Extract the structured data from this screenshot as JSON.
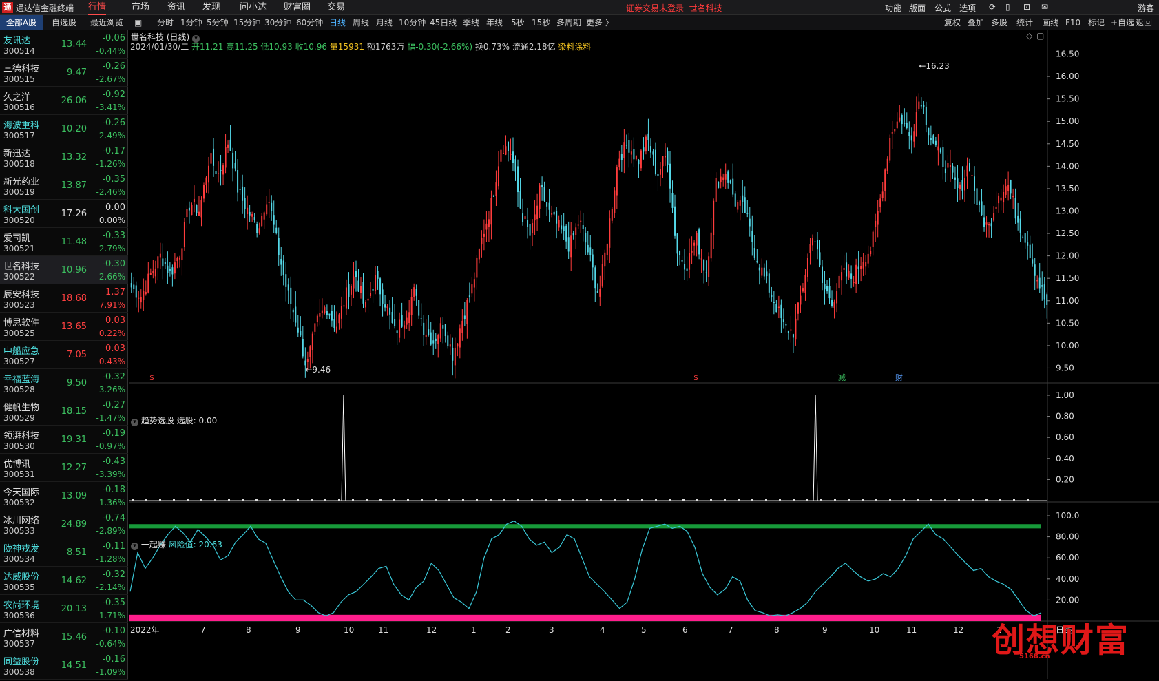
{
  "titlebar": {
    "app_name": "通达信金融终端",
    "logo_glyph": "通",
    "menus": [
      "行情",
      "市场",
      "资讯",
      "发现",
      "问小达",
      "财富圈",
      "交易"
    ],
    "active_menu": "行情",
    "notice": "证券交易未登录",
    "notice_stock": "世名科技",
    "right_tools": [
      "功能",
      "版面",
      "公式",
      "选项"
    ],
    "user": "游客"
  },
  "toolbar": {
    "list_tabs": [
      "全部A股",
      "自选股",
      "最近浏览"
    ],
    "active_list_tab": "全部A股",
    "periods": [
      "分时",
      "1分钟",
      "5分钟",
      "15分钟",
      "30分钟",
      "60分钟",
      "日线",
      "周线",
      "月线",
      "10分钟",
      "45日线",
      "季线",
      "年线",
      "5秒",
      "15秒",
      "多周期",
      "更多 〉"
    ],
    "active_period": "日线",
    "right_buttons": [
      "复权",
      "叠加",
      "多股",
      "统计",
      "画线",
      "F10",
      "标记",
      "+自选",
      "返回"
    ]
  },
  "stocks": [
    {
      "name": "友讯达",
      "code": "300514",
      "price": "13.44",
      "change": "-0.06",
      "pct": "-0.44%",
      "dir": "dn",
      "name_color": "cy"
    },
    {
      "name": "三德科技",
      "code": "300515",
      "price": "9.47",
      "change": "-0.26",
      "pct": "-2.67%",
      "dir": "dn",
      "name_color": "fl"
    },
    {
      "name": "久之洋",
      "code": "300516",
      "price": "26.06",
      "change": "-0.92",
      "pct": "-3.41%",
      "dir": "dn",
      "name_color": "fl"
    },
    {
      "name": "海波重科",
      "code": "300517",
      "price": "10.20",
      "change": "-0.26",
      "pct": "-2.49%",
      "dir": "dn",
      "name_color": "cy"
    },
    {
      "name": "新迅达",
      "code": "300518",
      "price": "13.32",
      "change": "-0.17",
      "pct": "-1.26%",
      "dir": "dn",
      "name_color": "fl"
    },
    {
      "name": "新光药业",
      "code": "300519",
      "price": "13.87",
      "change": "-0.35",
      "pct": "-2.46%",
      "dir": "dn",
      "name_color": "fl"
    },
    {
      "name": "科大国创",
      "code": "300520",
      "price": "17.26",
      "change": "0.00",
      "pct": "0.00%",
      "dir": "fl",
      "name_color": "cy"
    },
    {
      "name": "爱司凯",
      "code": "300521",
      "price": "11.48",
      "change": "-0.33",
      "pct": "-2.79%",
      "dir": "dn",
      "name_color": "fl"
    },
    {
      "name": "世名科技",
      "code": "300522",
      "price": "10.96",
      "change": "-0.30",
      "pct": "-2.66%",
      "dir": "dn",
      "name_color": "fl",
      "selected": true
    },
    {
      "name": "辰安科技",
      "code": "300523",
      "price": "18.68",
      "change": "1.37",
      "pct": "7.91%",
      "dir": "up",
      "name_color": "fl"
    },
    {
      "name": "博思软件",
      "code": "300525",
      "price": "13.65",
      "change": "0.03",
      "pct": "0.22%",
      "dir": "up",
      "name_color": "fl"
    },
    {
      "name": "中船应急",
      "code": "300527",
      "price": "7.05",
      "change": "0.03",
      "pct": "0.43%",
      "dir": "up",
      "name_color": "cy"
    },
    {
      "name": "幸福蓝海",
      "code": "300528",
      "price": "9.50",
      "change": "-0.32",
      "pct": "-3.26%",
      "dir": "dn",
      "name_color": "cy"
    },
    {
      "name": "健帆生物",
      "code": "300529",
      "price": "18.15",
      "change": "-0.27",
      "pct": "-1.47%",
      "dir": "dn",
      "name_color": "fl"
    },
    {
      "name": "领湃科技",
      "code": "300530",
      "price": "19.31",
      "change": "-0.19",
      "pct": "-0.97%",
      "dir": "dn",
      "name_color": "fl"
    },
    {
      "name": "优博讯",
      "code": "300531",
      "price": "12.27",
      "change": "-0.43",
      "pct": "-3.39%",
      "dir": "dn",
      "name_color": "fl"
    },
    {
      "name": "今天国际",
      "code": "300532",
      "price": "13.09",
      "change": "-0.18",
      "pct": "-1.36%",
      "dir": "dn",
      "name_color": "fl"
    },
    {
      "name": "冰川网络",
      "code": "300533",
      "price": "24.89",
      "change": "-0.74",
      "pct": "-2.89%",
      "dir": "dn",
      "name_color": "fl"
    },
    {
      "name": "陇神戎发",
      "code": "300534",
      "price": "8.51",
      "change": "-0.11",
      "pct": "-1.28%",
      "dir": "dn",
      "name_color": "cy"
    },
    {
      "name": "达威股份",
      "code": "300535",
      "price": "14.62",
      "change": "-0.32",
      "pct": "-2.14%",
      "dir": "dn",
      "name_color": "cy"
    },
    {
      "name": "农尚环境",
      "code": "300536",
      "price": "20.13",
      "change": "-0.35",
      "pct": "-1.71%",
      "dir": "dn",
      "name_color": "cy"
    },
    {
      "name": "广信材料",
      "code": "300537",
      "price": "15.46",
      "change": "-0.10",
      "pct": "-0.64%",
      "dir": "dn",
      "name_color": "fl"
    },
    {
      "name": "同益股份",
      "code": "300538",
      "price": "14.51",
      "change": "-0.16",
      "pct": "-1.09%",
      "dir": "dn",
      "name_color": "cy"
    }
  ],
  "chart_header": {
    "title": "世名科技 (日线)",
    "date": "2024/01/30/二",
    "open": "开11.21",
    "high": "高11.25",
    "low": "低10.93",
    "close": "收10.96",
    "volume": "量15931",
    "amount": "额1763万",
    "range": "幅-0.30(-2.66%)",
    "turnover": "换0.73%",
    "float": "流通2.18亿",
    "sector": "染料涂料"
  },
  "colors": {
    "up": "#ff3c3c",
    "down": "#54d8e8",
    "band_top": "#179a3a",
    "band_bottom": "#ff1e8c",
    "line": "#3ac8d8",
    "pane_bg": "#000000",
    "accent": "#1e3f74"
  },
  "chart_data": [
    {
      "type": "candlestick",
      "title": "世名科技 (日线)",
      "x_labels": [
        "2022年",
        "7",
        "8",
        "9",
        "10",
        "11",
        "12",
        "1",
        "2",
        "3",
        "4",
        "5",
        "6",
        "7",
        "8",
        "9",
        "10",
        "11",
        "12",
        "1"
      ],
      "ylim": [
        9.2,
        16.6
      ],
      "yticks": [
        "16.50",
        "16.00",
        "15.50",
        "15.00",
        "14.50",
        "14.00",
        "13.50",
        "13.00",
        "12.50",
        "12.00",
        "11.50",
        "11.00",
        "10.50",
        "10.00",
        "9.50"
      ],
      "annotations": {
        "max": "16.23",
        "min": "9.46",
        "max_label": "←16.23",
        "min_label": "←9.46"
      },
      "markers": [
        {
          "label": "$",
          "x": "6",
          "color": "#ff3c3c"
        },
        {
          "label": "$",
          "x": "6b",
          "color": "#ff3c3c"
        },
        {
          "label": "减",
          "x": "9",
          "color": "#3cc060"
        },
        {
          "label": "财",
          "x": "10",
          "color": "#5aa0ff"
        }
      ],
      "keypoints": [
        11.3,
        11.1,
        11.6,
        12.0,
        11.6,
        12.1,
        13.2,
        13.0,
        14.2,
        13.8,
        14.6,
        13.4,
        13.0,
        12.6,
        13.4,
        12.2,
        11.2,
        10.5,
        9.5,
        10.5,
        10.9,
        10.4,
        11.1,
        11.6,
        10.8,
        11.5,
        11.0,
        10.3,
        10.6,
        11.2,
        10.4,
        10.1,
        10.5,
        9.8,
        10.6,
        11.3,
        12.4,
        13.2,
        14.5,
        14.3,
        13.0,
        12.4,
        13.5,
        12.9,
        12.6,
        12.2,
        12.8,
        12.0,
        11.1,
        12.6,
        14.2,
        14.5,
        14.1,
        14.6,
        13.8,
        14.3,
        12.1,
        11.8,
        12.4,
        11.6,
        13.6,
        13.9,
        13.2,
        13.0,
        12.1,
        11.5,
        11.0,
        10.4,
        10.3,
        11.4,
        12.6,
        11.3,
        11.0,
        11.6,
        11.5,
        11.9,
        12.2,
        13.4,
        14.8,
        15.1,
        14.6,
        15.6,
        14.7,
        14.2,
        13.9,
        13.4,
        14.1,
        13.0,
        12.6,
        13.4,
        13.6,
        12.8,
        12.3,
        11.5,
        10.9
      ],
      "last": "10.96"
    },
    {
      "type": "line",
      "title": "趋势选股",
      "legend": "趋势选股 选股: 0.00",
      "ylim": [
        0,
        1
      ],
      "yticks": [
        "1.00",
        "0.80",
        "0.60",
        "0.40",
        "0.20"
      ],
      "spikes": [
        {
          "at": 0.234,
          "value": 1
        },
        {
          "at": 0.748,
          "value": 1
        }
      ]
    },
    {
      "type": "line",
      "title": "一起赚",
      "legend_value": "风险值: 20.63",
      "ylim": [
        0,
        100
      ],
      "yticks": [
        "100.0",
        "80.00",
        "60.00",
        "40.00",
        "20.00"
      ],
      "bands": [
        {
          "name": "top",
          "from": 88,
          "to": 92
        },
        {
          "name": "bottom",
          "from": 0,
          "to": 6
        }
      ],
      "values": [
        28,
        65,
        50,
        60,
        72,
        82,
        90,
        84,
        75,
        87,
        80,
        72,
        58,
        62,
        75,
        82,
        90,
        78,
        74,
        58,
        42,
        28,
        20,
        20,
        15,
        8,
        5,
        8,
        18,
        25,
        28,
        35,
        42,
        50,
        52,
        35,
        25,
        20,
        32,
        38,
        55,
        48,
        35,
        22,
        18,
        12,
        28,
        60,
        78,
        82,
        92,
        95,
        90,
        78,
        72,
        75,
        65,
        70,
        82,
        78,
        60,
        42,
        35,
        28,
        20,
        12,
        18,
        40,
        68,
        88,
        90,
        92,
        88,
        90,
        85,
        70,
        45,
        32,
        25,
        30,
        42,
        38,
        20,
        10,
        8,
        5,
        6,
        5,
        8,
        12,
        18,
        28,
        35,
        42,
        50,
        55,
        48,
        42,
        38,
        40,
        45,
        42,
        50,
        62,
        78,
        85,
        92,
        82,
        78,
        70,
        62,
        55,
        48,
        50,
        42,
        38,
        35,
        30,
        20,
        10,
        5,
        8
      ]
    }
  ],
  "x_axis": {
    "labels": [
      "2022年",
      "7",
      "8",
      "9",
      "10",
      "11",
      "12",
      "1",
      "2",
      "3",
      "4",
      "5",
      "6",
      "7",
      "8",
      "9",
      "10",
      "11",
      "12",
      "1"
    ],
    "period_label": "日线"
  },
  "watermark": {
    "text": "创想财富",
    "url": "5168.cn"
  }
}
